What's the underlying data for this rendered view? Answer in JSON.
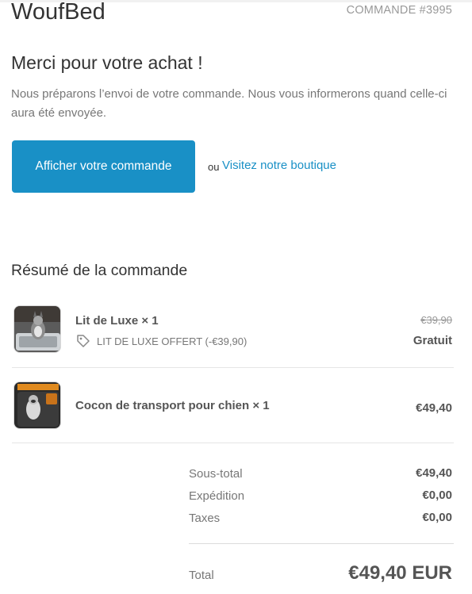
{
  "header": {
    "shop_name": "WoufBed",
    "order_number": "COMMANDE #3995"
  },
  "confirmation": {
    "title": "Merci pour votre achat !",
    "message": "Nous préparons l’envoi de votre commande. Nous vous informerons quand celle-ci aura été envoyée.",
    "view_order_label": "Afficher votre commande",
    "or_label": "ou",
    "shop_link_label": "Visitez notre boutique"
  },
  "summary": {
    "title": "Résumé de la commande",
    "items": [
      {
        "name": "Lit de Luxe × 1",
        "discount": "LIT DE LUXE OFFERT (-€39,90)",
        "original_price": "€39,90",
        "price": "Gratuit",
        "image": "dog-bed-photo"
      },
      {
        "name": "Cocon de transport pour chien × 1",
        "price": "€49,40",
        "image": "dog-car-seat-photo"
      }
    ],
    "totals": {
      "subtotal_label": "Sous-total",
      "subtotal_value": "€49,40",
      "shipping_label": "Expédition",
      "shipping_value": "€0,00",
      "taxes_label": "Taxes",
      "taxes_value": "€0,00",
      "total_label": "Total",
      "total_value": "€49,40 EUR"
    }
  },
  "colors": {
    "accent": "#1990c6",
    "text": "#333333",
    "muted": "#777777"
  }
}
